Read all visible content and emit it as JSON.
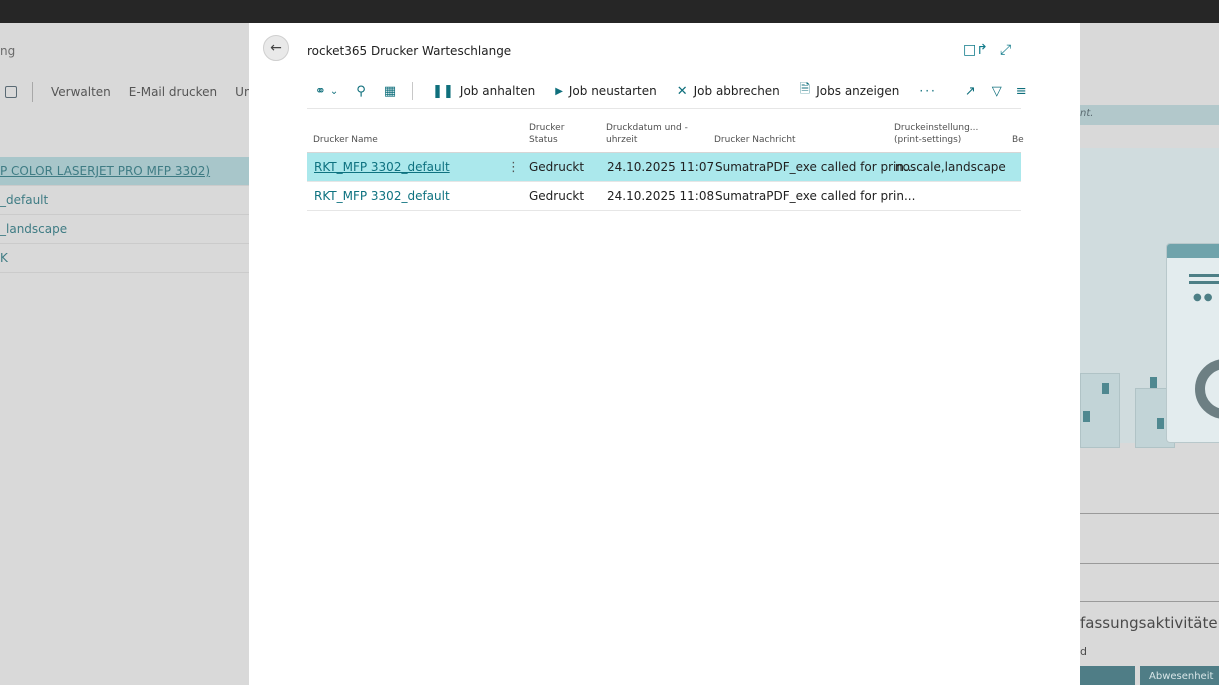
{
  "background_page": {
    "title_fragment": "ng",
    "toolbar": [
      "Verwalten",
      "E-Mail drucken",
      "Univ"
    ],
    "rows": [
      {
        "label": "P COLOR LASERJET PRO MFP 3302)",
        "selected": true
      },
      {
        "label": "_default",
        "selected": false
      },
      {
        "label": "_landscape",
        "selected": false
      },
      {
        "label": "K",
        "selected": false
      }
    ],
    "right_notice": "nt.",
    "right_heading": "fassungsaktivitäten",
    "right_subtext": "d",
    "right_button": "Abwesenheit"
  },
  "dialog": {
    "title": "rocket365 Drucker Warteschlange",
    "back_icon": "arrow-left-icon",
    "window_icons": [
      "collapse-icon",
      "expand-icon"
    ],
    "actions": [
      {
        "label": "Job anhalten",
        "icon": "pause-icon"
      },
      {
        "label": "Job neustarten",
        "icon": "play-icon"
      },
      {
        "label": "Job abbrechen",
        "icon": "x-icon"
      },
      {
        "label": "Jobs anzeigen",
        "icon": "document-icon"
      }
    ],
    "more_label": "···",
    "columns": [
      {
        "line1": "Drucker Name",
        "line2": ""
      },
      {
        "line1": "Drucker",
        "line2": "Status"
      },
      {
        "line1": "Druckdatum und -",
        "line2": "uhrzeit"
      },
      {
        "line1": "Drucker Nachricht",
        "line2": ""
      },
      {
        "line1": "Druckeinstellung...",
        "line2": "(print-settings)"
      },
      {
        "line1": "Be",
        "line2": ""
      }
    ],
    "rows": [
      {
        "name": "RKT_MFP 3302_default",
        "status": "Gedruckt",
        "datetime": "24.10.2025 11:07",
        "message": "SumatraPDF_exe called for prin...",
        "settings": "noscale,landscape",
        "selected": true
      },
      {
        "name": "RKT_MFP 3302_default",
        "status": "Gedruckt",
        "datetime": "24.10.2025 11:08",
        "message": "SumatraPDF_exe called for prin...",
        "settings": "",
        "selected": false
      }
    ],
    "colors": {
      "accent": "#0f7a8a",
      "selected_row": "#abe8ec"
    }
  }
}
